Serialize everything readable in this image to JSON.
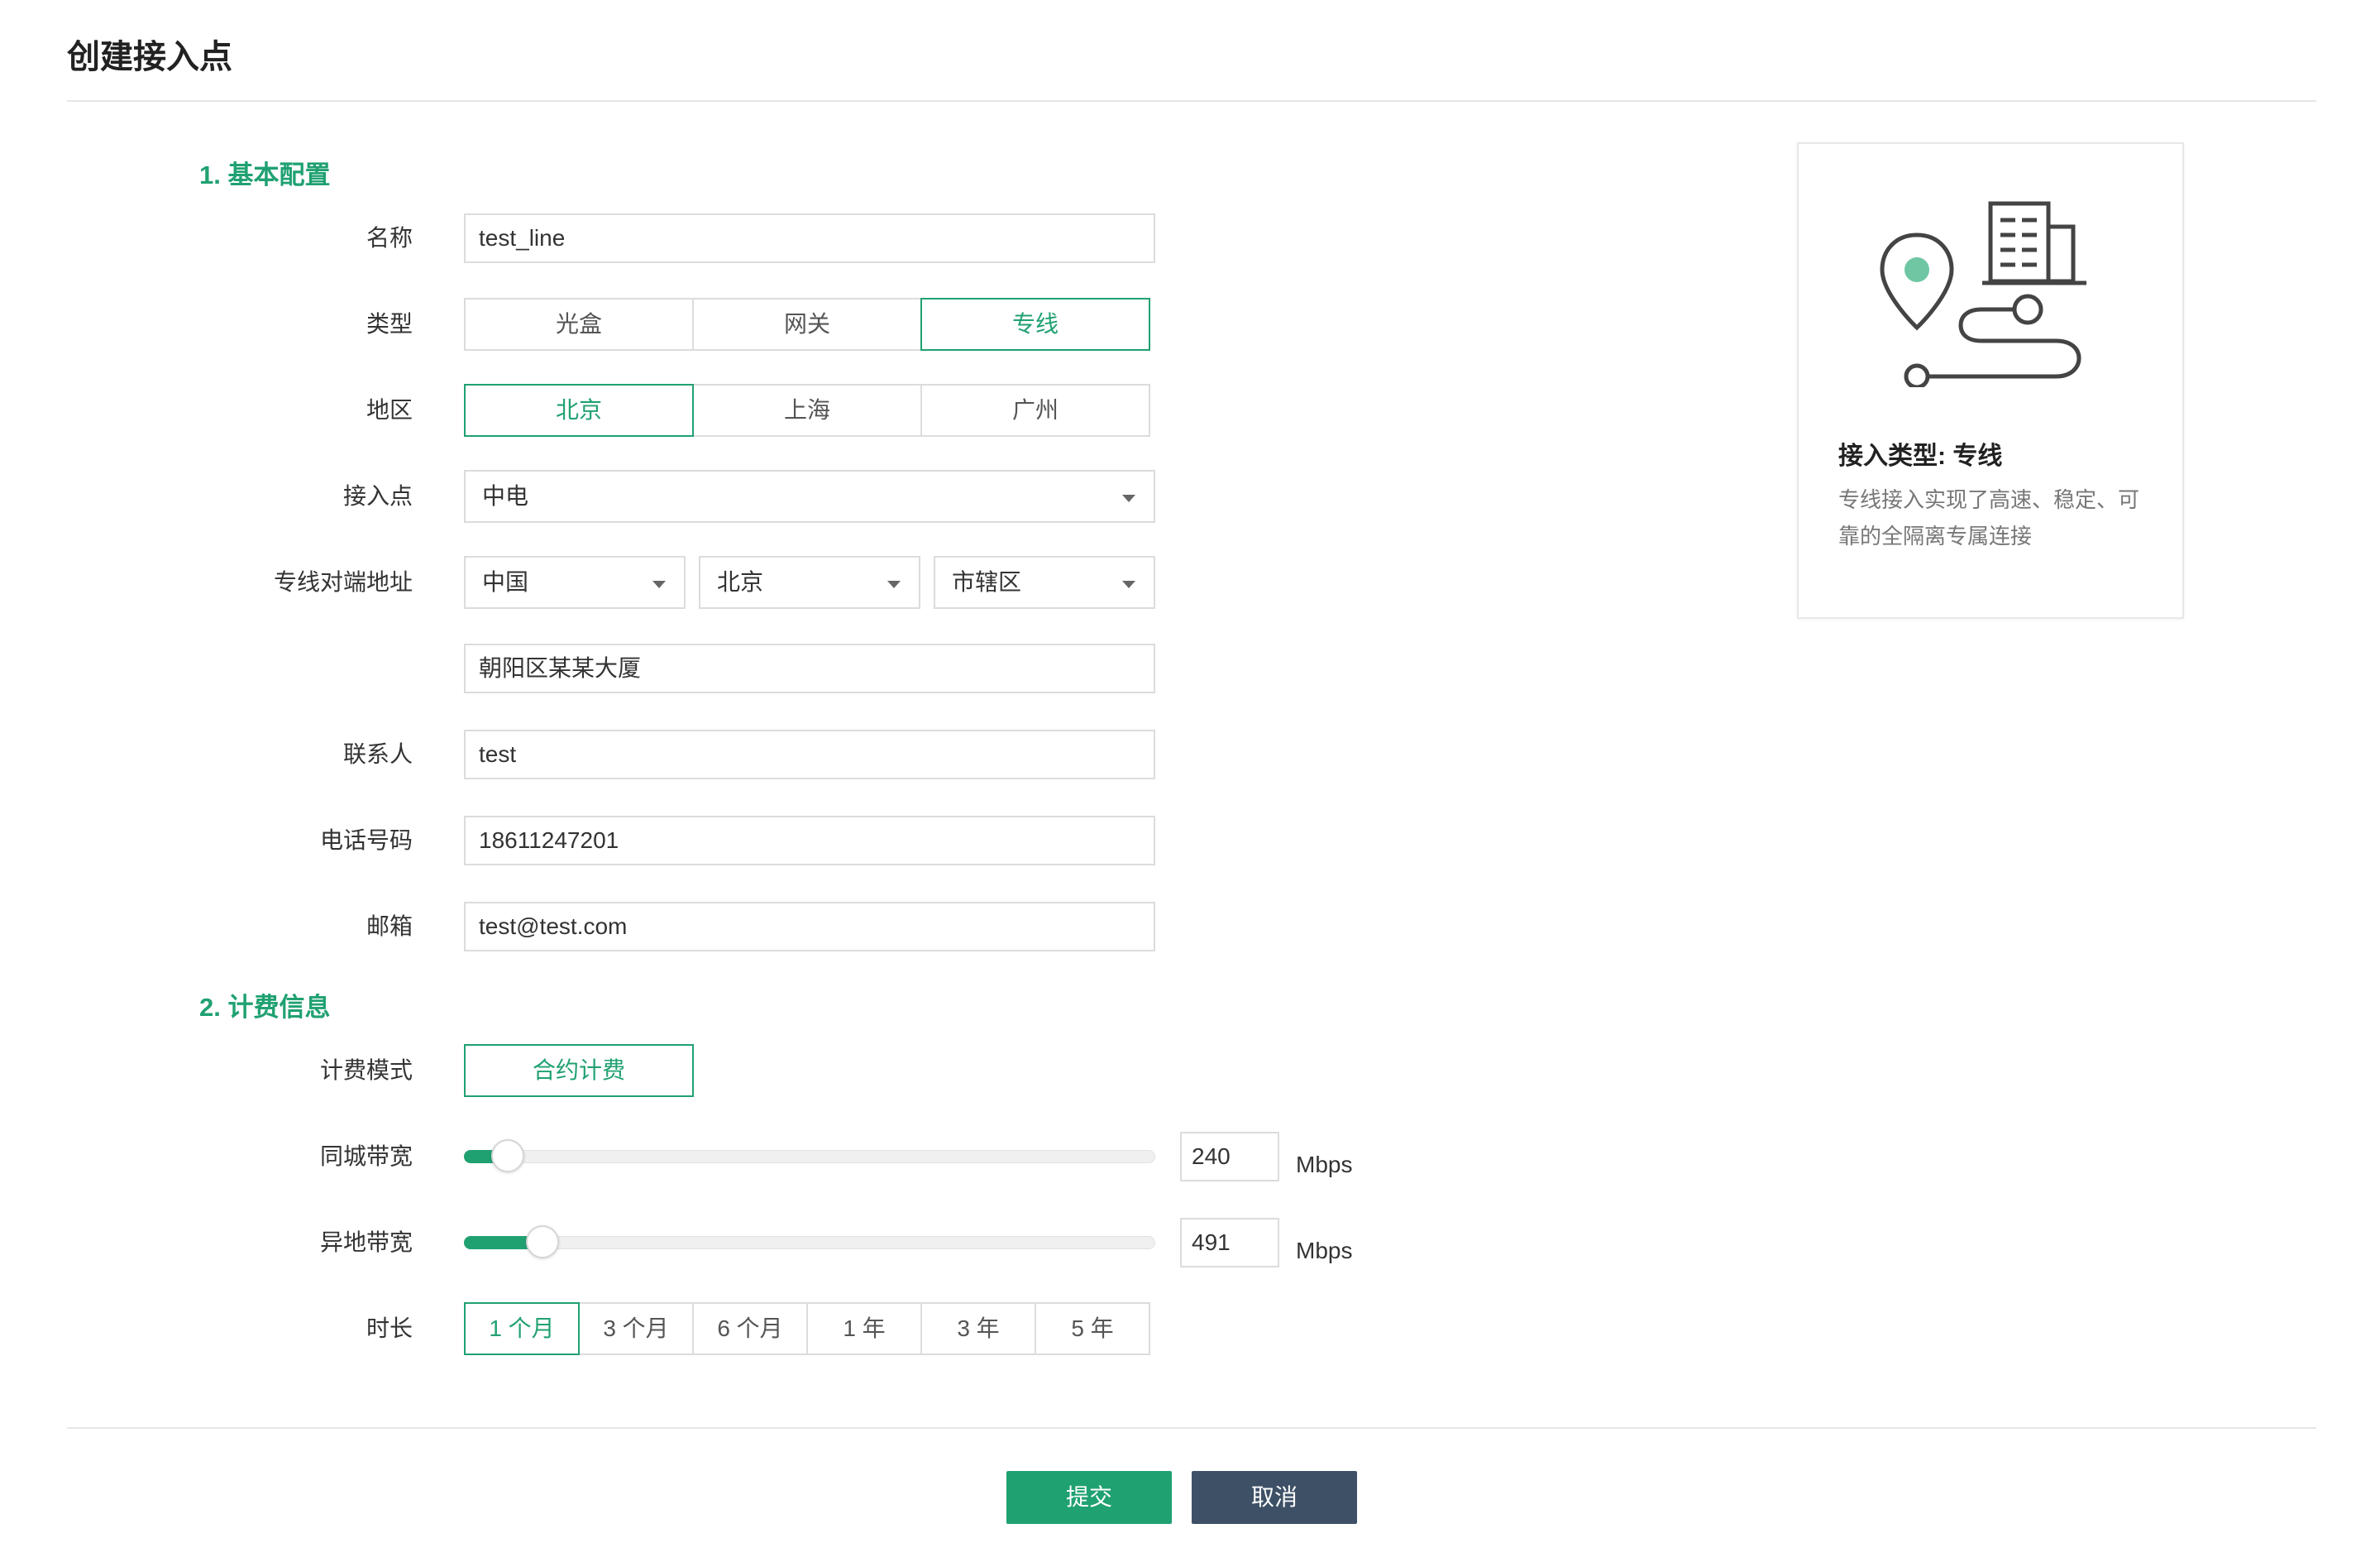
{
  "page": {
    "title": "创建接入点"
  },
  "sections": {
    "basic": "1. 基本配置",
    "billing": "2. 计费信息"
  },
  "form": {
    "name": {
      "label": "名称",
      "value": "test_line"
    },
    "type": {
      "label": "类型",
      "options": [
        "光盒",
        "网关",
        "专线"
      ],
      "selected": "专线"
    },
    "region": {
      "label": "地区",
      "options": [
        "北京",
        "上海",
        "广州"
      ],
      "selected": "北京"
    },
    "access_point": {
      "label": "接入点",
      "value": "中电"
    },
    "peer_address": {
      "label": "专线对端地址",
      "country": "中国",
      "province": "北京",
      "district": "市辖区",
      "detail": "朝阳区某某大厦"
    },
    "contact": {
      "label": "联系人",
      "value": "test"
    },
    "phone": {
      "label": "电话号码",
      "value": "18611247201"
    },
    "email": {
      "label": "邮箱",
      "value": "test@test.com"
    }
  },
  "billing": {
    "mode": {
      "label": "计费模式",
      "value": "合约计费"
    },
    "local_bandwidth": {
      "label": "同城带宽",
      "value": "240",
      "unit": "Mbps",
      "fill_fraction": 0.04
    },
    "remote_bandwidth": {
      "label": "异地带宽",
      "value": "491",
      "unit": "Mbps",
      "fill_fraction": 0.09
    },
    "duration": {
      "label": "时长",
      "options": [
        "1 个月",
        "3 个月",
        "6 个月",
        "1 年",
        "3 年",
        "5 年"
      ],
      "selected": "1 个月"
    }
  },
  "actions": {
    "submit": "提交",
    "cancel": "取消"
  },
  "info_card": {
    "title": "接入类型: 专线",
    "description": "专线接入实现了高速、稳定、可靠的全隔离专属连接",
    "icon": "location-building-route-icon"
  },
  "colors": {
    "accent": "#20a171",
    "cancel": "#3e5066",
    "border": "#dcdcdc"
  }
}
